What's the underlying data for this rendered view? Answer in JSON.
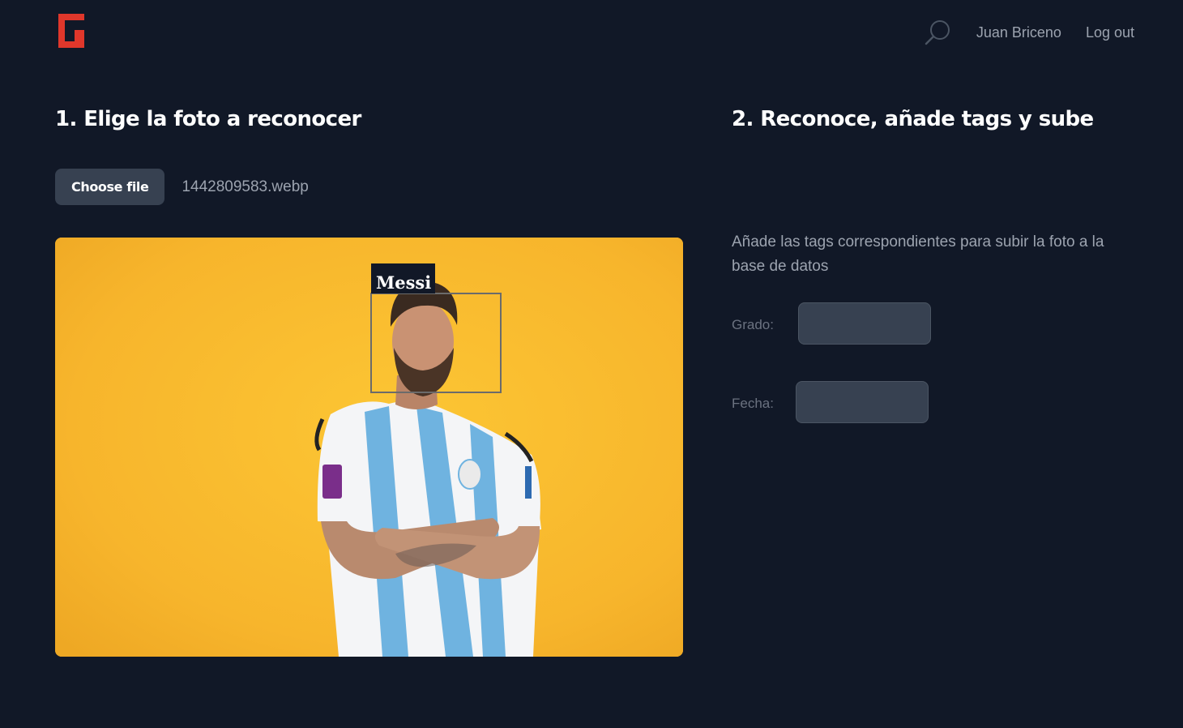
{
  "header": {
    "logo_icon": "brand-logo-icon",
    "search_icon": "search-icon",
    "user_name": "Juan Briceno",
    "logout_label": "Log out",
    "brand_color": "#e0372b"
  },
  "step1": {
    "title": "1. Elige la foto a reconocer",
    "choose_file_label": "Choose file",
    "file_name": "1442809583.webp",
    "detection_label": "Messi"
  },
  "step2": {
    "title": "2. Reconoce, añade tags y sube",
    "description": "Añade las tags correspondientes para subir la foto a la base de datos",
    "grado_label": "Grado:",
    "grado_value": "",
    "fecha_label": "Fecha:",
    "fecha_value": ""
  },
  "colors": {
    "background": "#111827",
    "photo_background": "#f7b52c",
    "button": "#374151"
  }
}
